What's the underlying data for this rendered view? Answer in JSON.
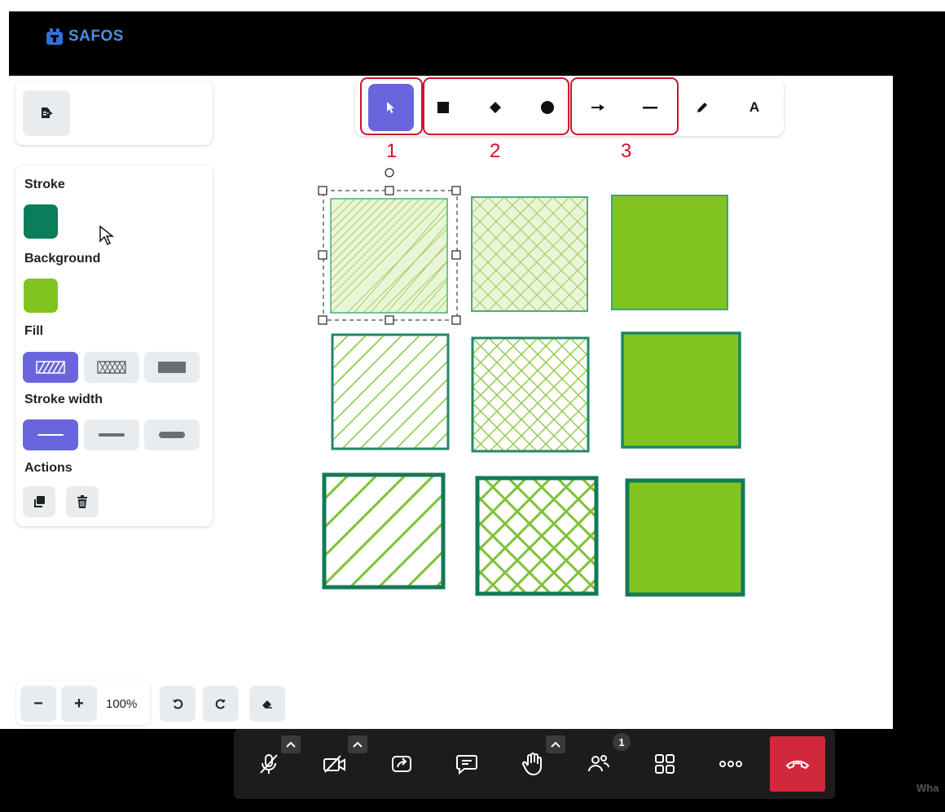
{
  "app": {
    "brand": "SAFOS"
  },
  "sidebar": {
    "stroke_label": "Stroke",
    "stroke_color": "#0b7d5a",
    "background_label": "Background",
    "background_color": "#82c41f",
    "fill_label": "Fill",
    "fill_options": [
      "hachure",
      "cross-hatch",
      "solid"
    ],
    "fill_selected": "hachure",
    "stroke_width_label": "Stroke width",
    "stroke_width_options": [
      "thin",
      "bold",
      "extra-bold"
    ],
    "stroke_width_selected": "thin",
    "actions_label": "Actions",
    "actions": [
      "duplicate-icon",
      "trash-icon"
    ]
  },
  "toolbar": {
    "tools": [
      "select",
      "rectangle",
      "diamond",
      "ellipse",
      "arrow",
      "line",
      "pencil",
      "text"
    ],
    "selected": "select",
    "text_tool_glyph": "A",
    "group_labels": [
      "1",
      "2",
      "3"
    ]
  },
  "zoom": {
    "minus": "−",
    "plus": "+",
    "level": "100%"
  },
  "history": [
    "undo-icon",
    "redo-icon",
    "eraser-icon"
  ],
  "canvas": {
    "stroke_color": "#0b7d5a",
    "fill_color": "#82c41f",
    "grid": [
      [
        "hachure",
        "cross-hatch",
        "solid"
      ],
      [
        "hachure",
        "cross-hatch",
        "solid"
      ],
      [
        "hachure",
        "cross-hatch",
        "solid"
      ]
    ]
  },
  "meeting_bar": {
    "participants_count": "1",
    "buttons": [
      "mic-off",
      "camera-off",
      "share-screen",
      "chat",
      "raise-hand",
      "participants",
      "tile-view",
      "more",
      "end-call"
    ]
  },
  "watermark": "Wha"
}
